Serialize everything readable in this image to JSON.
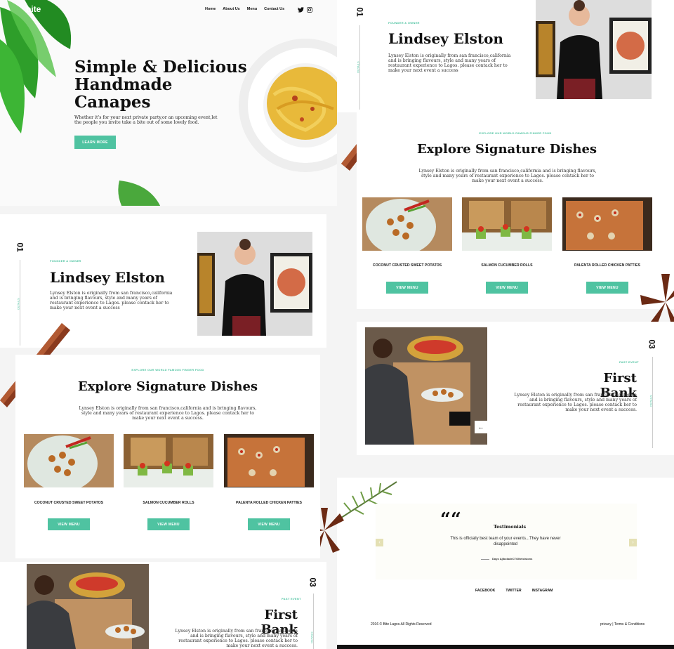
{
  "hero": {
    "logo": "bite",
    "nav": [
      "Home",
      "About Us",
      "Menu",
      "Contact Us"
    ],
    "title_lines": [
      "Simple & Delicious",
      "Handmade",
      "Canapes"
    ],
    "subtitle": "Whether it's for your next private party,or an upcoming event,let the people you invite take a bite out of some lovely food.",
    "cta": "LEARN MORE"
  },
  "founder": {
    "number": "01",
    "side_label": "DETAILS",
    "kicker": "FOUNDER & OWNER",
    "name": "Lindsey Elston",
    "bio": "Lynsey Elston is originally from san francisco,california and is bringing flavours, style and many years of restaurant experience to Lagos. please contack her to make your next event a success"
  },
  "dishes": {
    "kicker": "EXPLORE OUR WORLD FAMOUS FINGER FOOD",
    "title": "Explore Signature Dishes",
    "intro": "Lynsey Elston is originally from san francisco,california and is bringing flavours, style and many years of restaurant experience to Lagos. please contack her to make your next event a success.",
    "items": [
      {
        "name": "COCONUT CRUSTED SWEET POTATOS",
        "button": "VIEW MENU"
      },
      {
        "name": "SALMON CUCUMBER ROLLS",
        "button": "VIEW MENU"
      },
      {
        "name": "PALENTA ROLLED CHICKEN PATTIES",
        "button": "VIEW MENU"
      }
    ]
  },
  "event": {
    "number": "03",
    "side_label": "DETAILS",
    "kicker": "PAST EVENT",
    "title": "First Bank",
    "body": "Lynsey Elston is originally from san francisco,california and is bringing flavours, style and many years of restaurant experience to Lagos. please contack her to make your next event a success."
  },
  "testimonials": {
    "title": "Testimonials",
    "quote": "This is officially best team of your events...They have never disappointed",
    "author": "Dayo AjiboladeCTONetcisions",
    "social": [
      "FACEBOOK",
      "TWITTER",
      "INSTAGRAM"
    ],
    "copyright": "2016 © Bite Lagos.All Rights Reserved",
    "legal": "privacy | Terms & Conditions"
  },
  "colors": {
    "accent": "#4fc3a1",
    "text": "#111111",
    "bg": "#f4f4f4"
  }
}
